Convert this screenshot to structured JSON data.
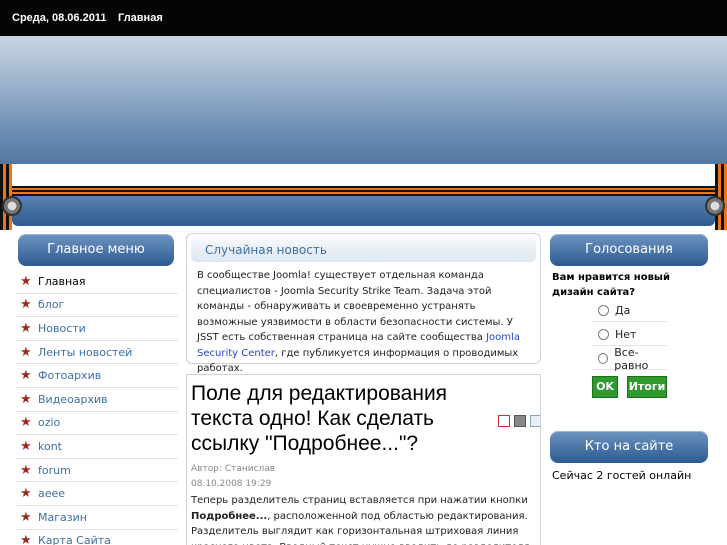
{
  "topbar": {
    "date": "Среда, 08.06.2011",
    "home_link": "Главная"
  },
  "main_menu": {
    "title": "Главное меню",
    "items": [
      "Главная",
      "блог",
      "Новости",
      "Ленты новостей",
      "Фотоархив",
      "Видеоархив",
      "ozio",
      "kont",
      "forum",
      "аеее",
      "Магазин",
      "Карта Сайта"
    ]
  },
  "random_news": {
    "title": "Случайная новость",
    "text_before": "В сообществе Joomla! существует отдельная команда специалистов - Joomla Security Strike Team. Задача этой команды - обнаруживать и своевременно устранять возможные уязвимости в области безопасности системы. У JSST есть собственная страница на сайте сообщества ",
    "link": "Joomla Security Center",
    "text_after": ", где публикуется информация о проводимых работах."
  },
  "article": {
    "title": "Поле для редактирования текста одно! Как сделать ссылку \"Подробнее...\"?",
    "author": "Автор: Станислав",
    "date": "08.10.2008 19:29",
    "body_before": "Теперь разделитель страниц вставляется при нажатии кнопки ",
    "body_bold": "Подробнее...",
    "body_after": ", расположенной под областью редактирования. Разделитель выглядит как горизонтальная штриховая линия красного цвета. Вводный текст нужно вводить до разделителя, а дополнительный - после."
  },
  "poll": {
    "title": "Голосования",
    "question": "Вам нравится новый дизайн сайта?",
    "options": [
      "Да",
      "Нет",
      "Все-равно"
    ],
    "vote_button": "OK",
    "results_button": "Итоги"
  },
  "who_online": {
    "title": "Кто на сайте",
    "text": "Сейчас 2 гостей онлайн"
  },
  "colors": {
    "accent_blue": "#2c5a91",
    "ribbon_orange": "#e8761a",
    "button_green": "#2e9a2e",
    "link_blue": "#3d6fa5"
  }
}
